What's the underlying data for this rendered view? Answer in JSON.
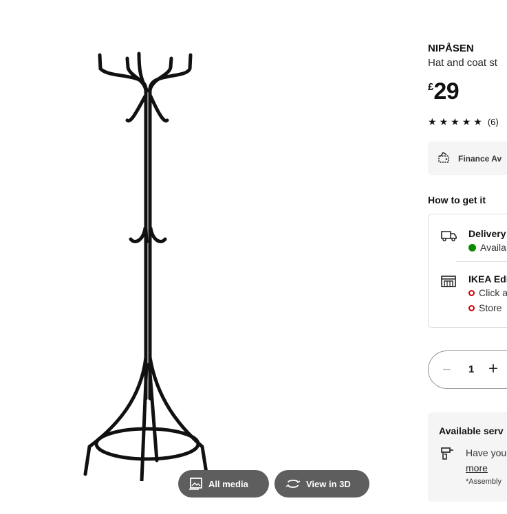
{
  "product": {
    "name": "NIPÅSEN",
    "description": "Hat and coat st",
    "currency": "£",
    "price": "29",
    "rating": 5,
    "rating_count": "(6)"
  },
  "finance": {
    "label": "Finance Av"
  },
  "get_it": {
    "heading": "How to get it",
    "delivery": {
      "title": "Delivery",
      "status": "Availa"
    },
    "store": {
      "title": "IKEA Edi",
      "click_collect": "Click a",
      "store_status": "Store"
    }
  },
  "quantity": {
    "value": "1",
    "minus": "−",
    "plus": "+"
  },
  "services": {
    "title": "Available serv",
    "line": "Have you",
    "link": "more",
    "note": "*Assembly"
  },
  "media_buttons": {
    "all_media": "All media",
    "view_3d": "View in 3D"
  },
  "colors": {
    "media_button_bg": "#5e5e5e",
    "available_green": "#0a8a00",
    "unavailable_red": "#cc0008"
  },
  "icons": [
    "image-gallery-icon",
    "rotate-3d-icon",
    "truck-icon",
    "store-icon",
    "wallet-icon",
    "drill-icon",
    "star-icon"
  ]
}
